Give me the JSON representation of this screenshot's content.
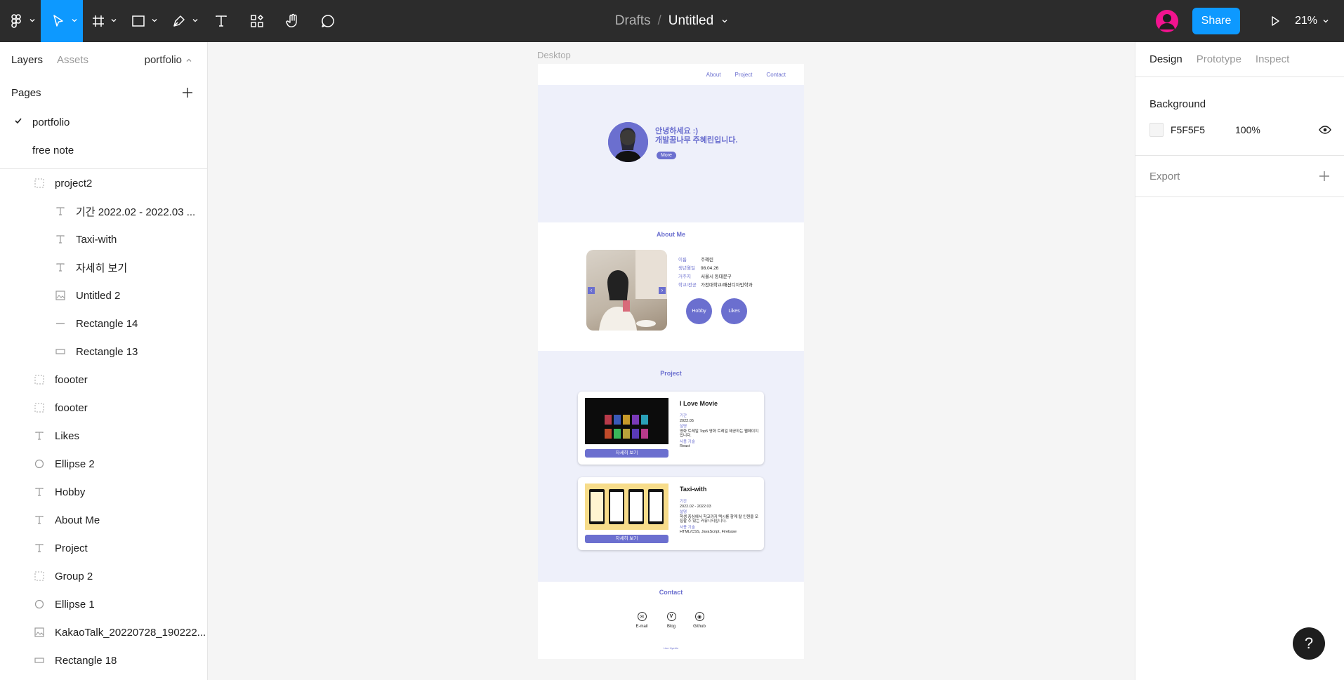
{
  "toolbar": {
    "breadcrumb_parent": "Drafts",
    "breadcrumb_sep": "/",
    "file_name": "Untitled",
    "share_label": "Share",
    "zoom": "21%",
    "tools": [
      "main-menu-icon",
      "move-icon",
      "frame-icon",
      "rectangle-icon",
      "pen-icon",
      "text-icon",
      "resources-icon",
      "hand-icon",
      "comment-icon",
      "present-icon"
    ]
  },
  "left_panel": {
    "tabs": [
      "Layers",
      "Assets"
    ],
    "page_selector": "portfolio",
    "pages_title": "Pages",
    "pages": [
      "portfolio",
      "free note"
    ],
    "layers": [
      {
        "name": "project2",
        "icon": "frame-icon"
      },
      {
        "name": "기간 2022.02 - 2022.03 ...",
        "icon": "text-icon"
      },
      {
        "name": "Taxi-with",
        "icon": "text-icon"
      },
      {
        "name": "자세히 보기",
        "icon": "text-icon"
      },
      {
        "name": "Untitled 2",
        "icon": "image-icon"
      },
      {
        "name": "Rectangle 14",
        "icon": "line-icon"
      },
      {
        "name": "Rectangle 13",
        "icon": "rectangle-icon"
      },
      {
        "name": "foooter",
        "icon": "frame-icon"
      },
      {
        "name": "foooter",
        "icon": "frame-icon"
      },
      {
        "name": "Likes",
        "icon": "text-icon"
      },
      {
        "name": "Ellipse 2",
        "icon": "ellipse-icon"
      },
      {
        "name": "Hobby",
        "icon": "text-icon"
      },
      {
        "name": "About Me",
        "icon": "text-icon"
      },
      {
        "name": "Project",
        "icon": "text-icon"
      },
      {
        "name": "Group 2",
        "icon": "frame-icon"
      },
      {
        "name": "Ellipse 1",
        "icon": "ellipse-icon"
      },
      {
        "name": "KakaoTalk_20220728_190222...",
        "icon": "image-icon"
      },
      {
        "name": "Rectangle 18",
        "icon": "rectangle-icon"
      }
    ]
  },
  "canvas": {
    "frame_label": "Desktop",
    "nav": [
      "About",
      "Project",
      "Contact"
    ],
    "hero": {
      "line1": "안녕하세요 :)",
      "line2": "개발꿈나무 주혜린입니다.",
      "more": "More"
    },
    "about": {
      "title": "About Me",
      "info": [
        {
          "k": "이름",
          "v": "주혜린"
        },
        {
          "k": "생년월일",
          "v": "98.04.26"
        },
        {
          "k": "거주지",
          "v": "서울시 동대문구"
        },
        {
          "k": "학교/전공",
          "v": "가천대학교/패션디자인학과"
        }
      ],
      "hobby": "Hobby",
      "likes": "Likes"
    },
    "project": {
      "title": "Project",
      "cards": [
        {
          "title": "I Love Movie",
          "period_label": "기간",
          "period": "2022.05",
          "desc_label": "설명",
          "desc": "영화 트레일 Top5 영화 트레일 제공하는 웹페이지입니다.",
          "tech_label": "사용 기술",
          "tech": "React",
          "button": "자세히 보기"
        },
        {
          "title": "Taxi-with",
          "period_label": "기간",
          "period": "2022.02 - 2022.03",
          "desc_label": "설명",
          "desc": "학생 중심에서 학교까지 택시를 함께 탈 인원을 모집할 수 있는 커뮤니티입니다.",
          "tech_label": "사용 기술",
          "tech": "HTML/CSS, JavaScript, Firebase",
          "button": "자세히 보기"
        }
      ]
    },
    "contact": {
      "title": "Contact",
      "items": [
        {
          "glyph": "✉",
          "label": "E-mail"
        },
        {
          "glyph": "V",
          "label": "Blog"
        },
        {
          "glyph": "◉",
          "label": "Github"
        }
      ],
      "copyright": "Line Hyerlin"
    }
  },
  "right_panel": {
    "tabs": [
      "Design",
      "Prototype",
      "Inspect"
    ],
    "background_title": "Background",
    "bg_hex": "F5F5F5",
    "bg_opacity": "100%",
    "export_title": "Export"
  },
  "help_label": "?",
  "colors": {
    "accent": "#0d99ff",
    "brand": "#6b6fcf",
    "toolbar": "#2c2c2c"
  }
}
